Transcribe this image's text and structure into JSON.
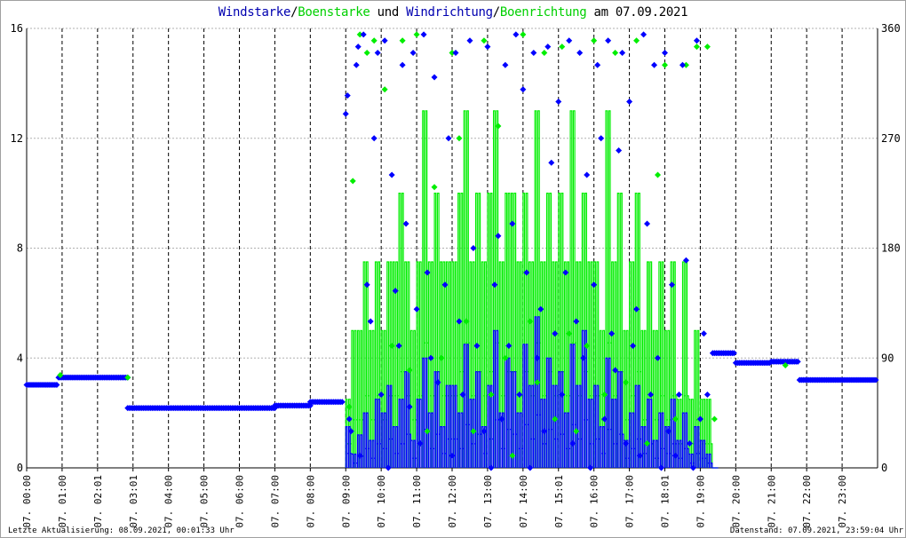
{
  "title": {
    "part1": "Windstarke",
    "sep1": "/",
    "part2": "Boenstarke",
    "mid": " und ",
    "part3": "Windrichtung",
    "sep2": "/",
    "part4": "Boenrichtung",
    "tail": " am 07.09.2021"
  },
  "footer": {
    "left": "Letzte Aktualisierung: 08.09.2021, 00:01:33 Uhr",
    "right": "Datenstand: 07.09.2021, 23:59:04 Uhr"
  },
  "colors": {
    "wind": "#0000ff",
    "gust": "#00ee00",
    "grid": "#b0b0b0",
    "title_blue": "#0000b0",
    "title_green": "#00d000"
  },
  "chart_data": {
    "type": "line",
    "title": "Windstarke/Boenstarke und Windrichtung/Boenrichtung am 07.09.2021",
    "x_range_hours": [
      0,
      24
    ],
    "x_tick_labels": [
      "07. 00:00",
      "07. 01:00",
      "07. 02:01",
      "07. 03:01",
      "07. 04:00",
      "07. 05:00",
      "07. 06:00",
      "07. 07:00",
      "07. 08:00",
      "07. 09:00",
      "07. 10:00",
      "07. 11:00",
      "07. 12:00",
      "07. 13:00",
      "07. 14:00",
      "07. 15:01",
      "07. 16:00",
      "07. 17:00",
      "07. 18:01",
      "07. 19:00",
      "07. 20:00",
      "07. 21:00",
      "07. 22:00",
      "07. 23:00"
    ],
    "y_left": {
      "range": [
        0,
        16
      ],
      "ticks": [
        "0",
        "4",
        "8",
        "12",
        "16"
      ]
    },
    "y_right": {
      "range": [
        0,
        360
      ],
      "ticks": [
        "0",
        "90",
        "180",
        "270",
        "360"
      ]
    },
    "speed_series": {
      "start_hour": 9.0,
      "step_hours": 0.1667,
      "wind": [
        1.5,
        0.5,
        1.2,
        2.0,
        1.0,
        2.5,
        2.0,
        3.0,
        1.5,
        2.5,
        3.5,
        1.0,
        2.5,
        4.0,
        2.0,
        3.5,
        1.5,
        3.0,
        3.0,
        2.0,
        4.5,
        2.5,
        3.5,
        1.5,
        3.0,
        5.0,
        2.0,
        4.0,
        3.5,
        2.0,
        4.5,
        3.0,
        5.5,
        2.5,
        4.0,
        3.0,
        3.5,
        2.0,
        4.5,
        3.0,
        5.0,
        2.5,
        3.0,
        1.5,
        4.0,
        2.5,
        3.5,
        1.0,
        2.0,
        3.0,
        1.5,
        2.5,
        1.0,
        2.0,
        1.5,
        2.5,
        1.0,
        2.0,
        0.5,
        1.5,
        1.0,
        0.5,
        0.0
      ],
      "gust": [
        2.5,
        5,
        5,
        7.5,
        5,
        7.5,
        5,
        7.5,
        7.5,
        10,
        7.5,
        5,
        7.5,
        13,
        7.5,
        10,
        7.5,
        7.5,
        7.5,
        10,
        13,
        7.5,
        10,
        7.5,
        10,
        13,
        7.5,
        10,
        10,
        7.5,
        10,
        7.5,
        13,
        7.5,
        10,
        7.5,
        10,
        7.5,
        13,
        7.5,
        10,
        7.5,
        7.5,
        5,
        13,
        7.5,
        10,
        5,
        7.5,
        10,
        5,
        7.5,
        5,
        7.5,
        5,
        7.5,
        2.5,
        7.5,
        2.5,
        5,
        2.5,
        2.5,
        0
      ]
    },
    "wind_direction_levels": [
      {
        "from": 0.0,
        "to": 0.9,
        "deg": 68
      },
      {
        "from": 0.9,
        "to": 2.85,
        "deg": 74
      },
      {
        "from": 2.85,
        "to": 7.0,
        "deg": 49
      },
      {
        "from": 7.0,
        "to": 8.0,
        "deg": 51
      },
      {
        "from": 8.0,
        "to": 8.95,
        "deg": 54
      },
      {
        "from": 19.35,
        "to": 20.0,
        "deg": 94
      },
      {
        "from": 20.0,
        "to": 21.0,
        "deg": 86
      },
      {
        "from": 21.0,
        "to": 21.8,
        "deg": 87
      },
      {
        "from": 21.8,
        "to": 24.0,
        "deg": 72
      }
    ],
    "wind_direction_points": [
      [
        9.0,
        290
      ],
      [
        9.05,
        305
      ],
      [
        9.1,
        40
      ],
      [
        9.15,
        30
      ],
      [
        9.3,
        330
      ],
      [
        9.35,
        345
      ],
      [
        9.4,
        10
      ],
      [
        9.5,
        355
      ],
      [
        9.6,
        150
      ],
      [
        9.7,
        120
      ],
      [
        9.8,
        270
      ],
      [
        9.9,
        340
      ],
      [
        10.0,
        60
      ],
      [
        10.1,
        350
      ],
      [
        10.2,
        0
      ],
      [
        10.3,
        240
      ],
      [
        10.4,
        145
      ],
      [
        10.5,
        100
      ],
      [
        10.6,
        330
      ],
      [
        10.7,
        200
      ],
      [
        10.8,
        50
      ],
      [
        10.9,
        340
      ],
      [
        11.0,
        130
      ],
      [
        11.1,
        20
      ],
      [
        11.2,
        355
      ],
      [
        11.3,
        160
      ],
      [
        11.4,
        90
      ],
      [
        11.5,
        320
      ],
      [
        11.6,
        70
      ],
      [
        11.8,
        150
      ],
      [
        11.9,
        270
      ],
      [
        12.0,
        10
      ],
      [
        12.1,
        340
      ],
      [
        12.2,
        120
      ],
      [
        12.3,
        60
      ],
      [
        12.5,
        350
      ],
      [
        12.6,
        180
      ],
      [
        12.7,
        100
      ],
      [
        12.9,
        30
      ],
      [
        13.0,
        345
      ],
      [
        13.1,
        0
      ],
      [
        13.2,
        150
      ],
      [
        13.3,
        190
      ],
      [
        13.4,
        40
      ],
      [
        13.5,
        330
      ],
      [
        13.6,
        100
      ],
      [
        13.7,
        200
      ],
      [
        13.8,
        355
      ],
      [
        13.9,
        60
      ],
      [
        14.0,
        310
      ],
      [
        14.1,
        160
      ],
      [
        14.2,
        0
      ],
      [
        14.3,
        340
      ],
      [
        14.4,
        90
      ],
      [
        14.5,
        130
      ],
      [
        14.6,
        30
      ],
      [
        14.7,
        345
      ],
      [
        14.8,
        250
      ],
      [
        14.9,
        110
      ],
      [
        15.0,
        300
      ],
      [
        15.1,
        60
      ],
      [
        15.2,
        160
      ],
      [
        15.3,
        350
      ],
      [
        15.4,
        20
      ],
      [
        15.5,
        120
      ],
      [
        15.6,
        340
      ],
      [
        15.7,
        90
      ],
      [
        15.8,
        240
      ],
      [
        15.9,
        0
      ],
      [
        16.0,
        150
      ],
      [
        16.1,
        330
      ],
      [
        16.2,
        270
      ],
      [
        16.3,
        40
      ],
      [
        16.4,
        350
      ],
      [
        16.5,
        110
      ],
      [
        16.6,
        80
      ],
      [
        16.7,
        260
      ],
      [
        16.8,
        340
      ],
      [
        16.9,
        20
      ],
      [
        17.0,
        300
      ],
      [
        17.1,
        100
      ],
      [
        17.2,
        130
      ],
      [
        17.3,
        10
      ],
      [
        17.4,
        355
      ],
      [
        17.5,
        200
      ],
      [
        17.6,
        60
      ],
      [
        17.7,
        330
      ],
      [
        17.8,
        90
      ],
      [
        17.9,
        0
      ],
      [
        18.0,
        340
      ],
      [
        18.1,
        30
      ],
      [
        18.2,
        150
      ],
      [
        18.3,
        10
      ],
      [
        18.4,
        60
      ],
      [
        18.5,
        330
      ],
      [
        18.6,
        170
      ],
      [
        18.7,
        20
      ],
      [
        18.8,
        0
      ],
      [
        18.9,
        350
      ],
      [
        19.0,
        40
      ],
      [
        19.1,
        110
      ],
      [
        19.2,
        60
      ]
    ],
    "gust_direction_points": [
      [
        0.95,
        76
      ],
      [
        2.85,
        74
      ],
      [
        9.1,
        50
      ],
      [
        9.2,
        235
      ],
      [
        9.4,
        355
      ],
      [
        9.6,
        340
      ],
      [
        9.8,
        350
      ],
      [
        10.1,
        310
      ],
      [
        10.3,
        100
      ],
      [
        10.6,
        350
      ],
      [
        10.8,
        80
      ],
      [
        11.0,
        355
      ],
      [
        11.3,
        30
      ],
      [
        11.5,
        230
      ],
      [
        11.7,
        90
      ],
      [
        12.0,
        340
      ],
      [
        12.2,
        270
      ],
      [
        12.4,
        120
      ],
      [
        12.6,
        30
      ],
      [
        12.9,
        350
      ],
      [
        13.1,
        60
      ],
      [
        13.3,
        280
      ],
      [
        13.5,
        90
      ],
      [
        13.7,
        10
      ],
      [
        14.0,
        355
      ],
      [
        14.2,
        120
      ],
      [
        14.4,
        70
      ],
      [
        14.6,
        340
      ],
      [
        14.9,
        40
      ],
      [
        15.1,
        345
      ],
      [
        15.3,
        110
      ],
      [
        15.5,
        30
      ],
      [
        15.8,
        100
      ],
      [
        16.0,
        350
      ],
      [
        16.3,
        60
      ],
      [
        16.6,
        340
      ],
      [
        16.9,
        70
      ],
      [
        17.2,
        350
      ],
      [
        17.5,
        20
      ],
      [
        17.8,
        240
      ],
      [
        18.0,
        330
      ],
      [
        18.3,
        40
      ],
      [
        18.6,
        330
      ],
      [
        18.9,
        345
      ],
      [
        19.2,
        345
      ],
      [
        19.4,
        40
      ],
      [
        21.4,
        84
      ]
    ]
  }
}
